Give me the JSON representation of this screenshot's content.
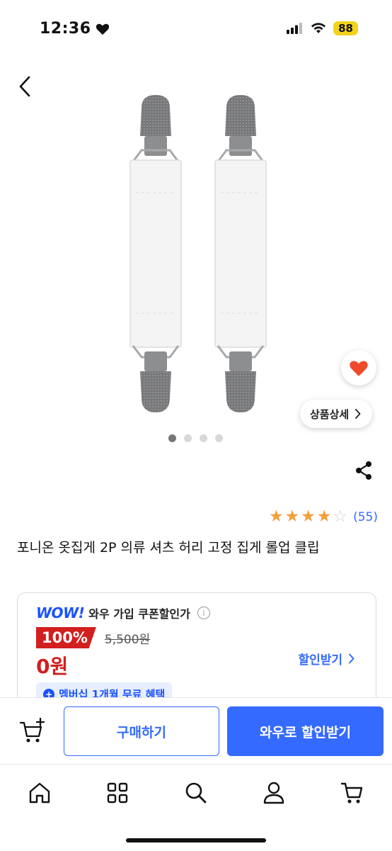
{
  "status_bar": {
    "time": "12:36",
    "battery": "88"
  },
  "product": {
    "title": "포니온 옷집게 2P 의류 셔츠 허리 고정 집게 롤업 클립",
    "detail_button": "상품상세",
    "rating": 4,
    "rating_max": 5,
    "review_count": "(55)",
    "carousel_total": 4,
    "carousel_active": 1
  },
  "price_card": {
    "wow_logo": "WOW!",
    "wow_text": "와우 가입 쿠폰할인가",
    "info_icon": "i",
    "discount_badge": "100%",
    "original_price": "5,500원",
    "final_price": "0원",
    "coupon_link": "할인받기",
    "membership_text": "멤버십 1개월 무료 혜택"
  },
  "actions": {
    "buy_label": "구매하기",
    "wow_label": "와우로 할인받기"
  },
  "colors": {
    "accent": "#346aff",
    "wow_blue": "#1b51ff",
    "sale_red": "#d21f1f",
    "star": "#f29f3a",
    "heart": "#ef4b2a",
    "battery": "#f2d21b"
  },
  "icons": {
    "back": "chevron-left-icon",
    "heart": "heart-icon",
    "share": "share-icon",
    "cart_add": "cart-add-icon",
    "tabs": [
      "home-icon",
      "category-icon",
      "search-icon",
      "profile-icon",
      "cart-icon"
    ]
  }
}
